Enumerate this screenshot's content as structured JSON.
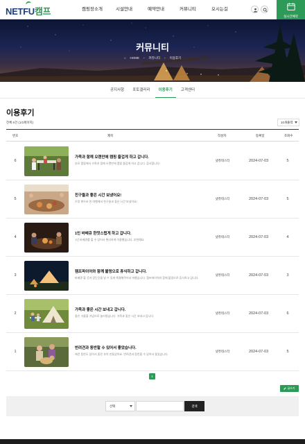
{
  "header": {
    "logo_part1": "NETFU",
    "logo_part2": "캠프",
    "nav": [
      "캠핑장소개",
      "시설안내",
      "예약안내",
      "커뮤니티",
      "오시는길"
    ],
    "reserve_label": "실시간예약",
    "colors": {
      "accent": "#2e9a57",
      "logo_blue": "#1f3f7a"
    }
  },
  "hero": {
    "title": "커뮤니티",
    "breadcrumb": [
      "HOME",
      "커뮤니티",
      "이용후기"
    ]
  },
  "tabs": [
    {
      "label": "공지사항",
      "active": false
    },
    {
      "label": "포토갤러리",
      "active": false
    },
    {
      "label": "이용후기",
      "active": true
    },
    {
      "label": "고객센터",
      "active": false
    }
  ],
  "page": {
    "title": "이용후기",
    "total": "전체 6건 (1/1페이지)",
    "sort_selected": "10개출력"
  },
  "table": {
    "columns": [
      "번호",
      "제목",
      "작성자",
      "등록일",
      "조회수"
    ],
    "rows": [
      {
        "no": "6",
        "title": "가족과 함께 오랜만에 캠핑 즐겁게 하고 갑니다.",
        "excerpt": "부모 캠핑에서 가족과 함께 오랜만에 캠핑 즐겁게 하고 갑니다. 감사합니다!",
        "author": "넷퓨테스터",
        "date": "2024-07-03",
        "views": "5"
      },
      {
        "no": "5",
        "title": "친구들과 좋은 시간 보냈어요!",
        "excerpt": "우정 쌓으러 친 여행에서 친구들과 좋은 시간 보냈어요!",
        "author": "넷퓨테스터",
        "date": "2024-07-03",
        "views": "5"
      },
      {
        "no": "4",
        "title": "1인 바베큐 한껏스럽게 하고 갑니다.",
        "excerpt": "1인 바베큐를 할 수 있어서 편리하게 이용했습니다. 추천해요.",
        "author": "넷퓨테스터",
        "date": "2024-07-03",
        "views": "4"
      },
      {
        "no": "3",
        "title": "캠프파이어와 함께 불멍으로 휴식하고 갑니다.",
        "excerpt": "바베큐 할 곳과 장단곳을 날 수 있게 해결해주어서 마했습니다. 캠프파이어와 함께 불멍으로 휴식하고 갑니다.",
        "author": "넷퓨테스터",
        "date": "2024-07-03",
        "views": "3"
      },
      {
        "no": "2",
        "title": "가족과 좋은 시간 보내고 갑니다.",
        "excerpt": "좋은 가을을 기념으로 놀러왔습니다. 가족과 좋은 시간 보내고 갑니다.",
        "author": "넷퓨테스터",
        "date": "2024-07-03",
        "views": "6"
      },
      {
        "no": "1",
        "title": "반려견과 동반할 수 있어서 좋았습니다.",
        "excerpt": "애견 동반도 있어서 좋은 추억 만들었어요. 반려견과 동반할 수 있어서 좋았습니다.",
        "author": "넷퓨테스터",
        "date": "2024-07-03",
        "views": "5"
      }
    ]
  },
  "pagination": {
    "current": "1"
  },
  "write_button": "글쓰기",
  "search": {
    "select_label": "선택",
    "input_value": "",
    "button_label": "검색"
  }
}
